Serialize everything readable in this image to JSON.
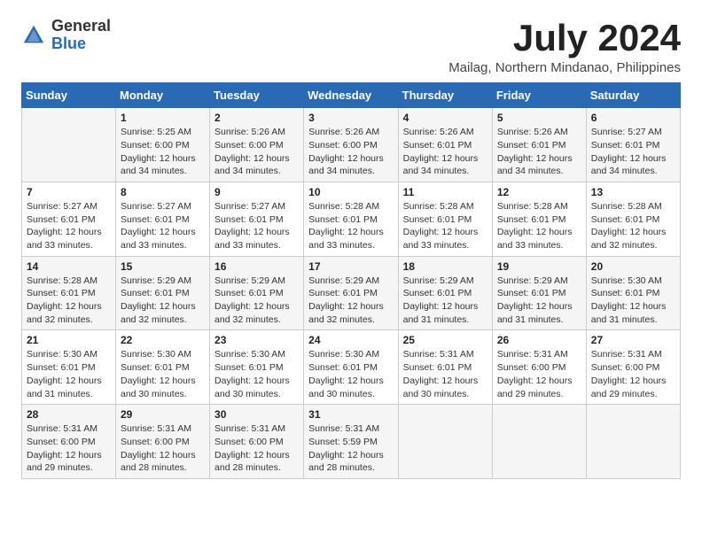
{
  "logo": {
    "general": "General",
    "blue": "Blue"
  },
  "title": "July 2024",
  "location": "Mailag, Northern Mindanao, Philippines",
  "headers": [
    "Sunday",
    "Monday",
    "Tuesday",
    "Wednesday",
    "Thursday",
    "Friday",
    "Saturday"
  ],
  "weeks": [
    [
      {
        "day": "",
        "info": ""
      },
      {
        "day": "1",
        "info": "Sunrise: 5:25 AM\nSunset: 6:00 PM\nDaylight: 12 hours\nand 34 minutes."
      },
      {
        "day": "2",
        "info": "Sunrise: 5:26 AM\nSunset: 6:00 PM\nDaylight: 12 hours\nand 34 minutes."
      },
      {
        "day": "3",
        "info": "Sunrise: 5:26 AM\nSunset: 6:00 PM\nDaylight: 12 hours\nand 34 minutes."
      },
      {
        "day": "4",
        "info": "Sunrise: 5:26 AM\nSunset: 6:01 PM\nDaylight: 12 hours\nand 34 minutes."
      },
      {
        "day": "5",
        "info": "Sunrise: 5:26 AM\nSunset: 6:01 PM\nDaylight: 12 hours\nand 34 minutes."
      },
      {
        "day": "6",
        "info": "Sunrise: 5:27 AM\nSunset: 6:01 PM\nDaylight: 12 hours\nand 34 minutes."
      }
    ],
    [
      {
        "day": "7",
        "info": "Sunrise: 5:27 AM\nSunset: 6:01 PM\nDaylight: 12 hours\nand 33 minutes."
      },
      {
        "day": "8",
        "info": "Sunrise: 5:27 AM\nSunset: 6:01 PM\nDaylight: 12 hours\nand 33 minutes."
      },
      {
        "day": "9",
        "info": "Sunrise: 5:27 AM\nSunset: 6:01 PM\nDaylight: 12 hours\nand 33 minutes."
      },
      {
        "day": "10",
        "info": "Sunrise: 5:28 AM\nSunset: 6:01 PM\nDaylight: 12 hours\nand 33 minutes."
      },
      {
        "day": "11",
        "info": "Sunrise: 5:28 AM\nSunset: 6:01 PM\nDaylight: 12 hours\nand 33 minutes."
      },
      {
        "day": "12",
        "info": "Sunrise: 5:28 AM\nSunset: 6:01 PM\nDaylight: 12 hours\nand 33 minutes."
      },
      {
        "day": "13",
        "info": "Sunrise: 5:28 AM\nSunset: 6:01 PM\nDaylight: 12 hours\nand 32 minutes."
      }
    ],
    [
      {
        "day": "14",
        "info": "Sunrise: 5:28 AM\nSunset: 6:01 PM\nDaylight: 12 hours\nand 32 minutes."
      },
      {
        "day": "15",
        "info": "Sunrise: 5:29 AM\nSunset: 6:01 PM\nDaylight: 12 hours\nand 32 minutes."
      },
      {
        "day": "16",
        "info": "Sunrise: 5:29 AM\nSunset: 6:01 PM\nDaylight: 12 hours\nand 32 minutes."
      },
      {
        "day": "17",
        "info": "Sunrise: 5:29 AM\nSunset: 6:01 PM\nDaylight: 12 hours\nand 32 minutes."
      },
      {
        "day": "18",
        "info": "Sunrise: 5:29 AM\nSunset: 6:01 PM\nDaylight: 12 hours\nand 31 minutes."
      },
      {
        "day": "19",
        "info": "Sunrise: 5:29 AM\nSunset: 6:01 PM\nDaylight: 12 hours\nand 31 minutes."
      },
      {
        "day": "20",
        "info": "Sunrise: 5:30 AM\nSunset: 6:01 PM\nDaylight: 12 hours\nand 31 minutes."
      }
    ],
    [
      {
        "day": "21",
        "info": "Sunrise: 5:30 AM\nSunset: 6:01 PM\nDaylight: 12 hours\nand 31 minutes."
      },
      {
        "day": "22",
        "info": "Sunrise: 5:30 AM\nSunset: 6:01 PM\nDaylight: 12 hours\nand 30 minutes."
      },
      {
        "day": "23",
        "info": "Sunrise: 5:30 AM\nSunset: 6:01 PM\nDaylight: 12 hours\nand 30 minutes."
      },
      {
        "day": "24",
        "info": "Sunrise: 5:30 AM\nSunset: 6:01 PM\nDaylight: 12 hours\nand 30 minutes."
      },
      {
        "day": "25",
        "info": "Sunrise: 5:31 AM\nSunset: 6:01 PM\nDaylight: 12 hours\nand 30 minutes."
      },
      {
        "day": "26",
        "info": "Sunrise: 5:31 AM\nSunset: 6:00 PM\nDaylight: 12 hours\nand 29 minutes."
      },
      {
        "day": "27",
        "info": "Sunrise: 5:31 AM\nSunset: 6:00 PM\nDaylight: 12 hours\nand 29 minutes."
      }
    ],
    [
      {
        "day": "28",
        "info": "Sunrise: 5:31 AM\nSunset: 6:00 PM\nDaylight: 12 hours\nand 29 minutes."
      },
      {
        "day": "29",
        "info": "Sunrise: 5:31 AM\nSunset: 6:00 PM\nDaylight: 12 hours\nand 28 minutes."
      },
      {
        "day": "30",
        "info": "Sunrise: 5:31 AM\nSunset: 6:00 PM\nDaylight: 12 hours\nand 28 minutes."
      },
      {
        "day": "31",
        "info": "Sunrise: 5:31 AM\nSunset: 5:59 PM\nDaylight: 12 hours\nand 28 minutes."
      },
      {
        "day": "",
        "info": ""
      },
      {
        "day": "",
        "info": ""
      },
      {
        "day": "",
        "info": ""
      }
    ]
  ]
}
